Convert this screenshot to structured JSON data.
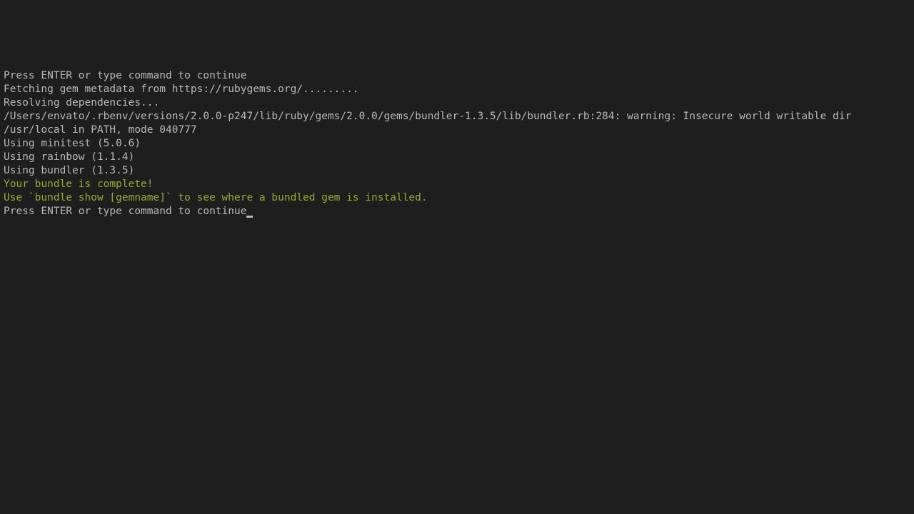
{
  "terminal": {
    "lines": {
      "l0": "Press ENTER or type command to continue",
      "l1": "Fetching gem metadata from https://rubygems.org/.........",
      "l2": "Resolving dependencies...",
      "l3": "/Users/envato/.rbenv/versions/2.0.0-p247/lib/ruby/gems/2.0.0/gems/bundler-1.3.5/lib/bundler.rb:284: warning: Insecure world writable dir /usr/local in PATH, mode 040777",
      "l4": "Using minitest (5.0.6)",
      "l5": "Using rainbow (1.1.4)",
      "l6": "Using bundler (1.3.5)",
      "l7": "Your bundle is complete!",
      "l8": "Use `bundle show [gemname]` to see where a bundled gem is installed.",
      "l9": "",
      "l10": "Press ENTER or type command to continue"
    }
  }
}
